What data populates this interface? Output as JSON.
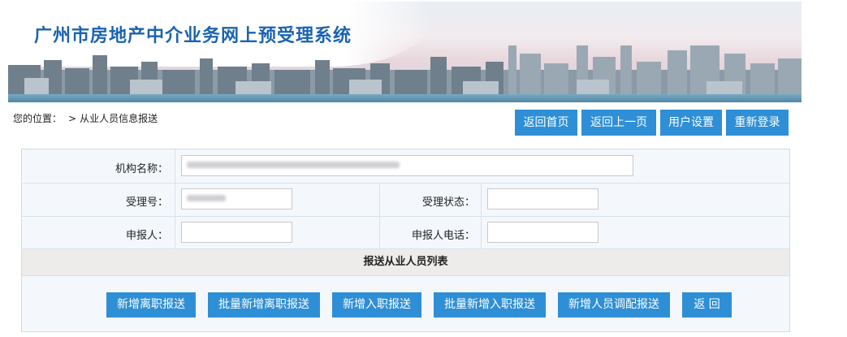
{
  "header": {
    "title": "广州市房地产中介业务网上预受理系统"
  },
  "breadcrumb": {
    "label": "您的位置：",
    "separator": ">",
    "current": "从业人员信息报送"
  },
  "nav": {
    "home": "返回首页",
    "back": "返回上一页",
    "user_settings": "用户设置",
    "relogin": "重新登录"
  },
  "form": {
    "org_name_label": "机构名称：",
    "acceptance_no_label": "受理号：",
    "acceptance_status_label": "受理状态：",
    "applicant_label": "申报人：",
    "applicant_phone_label": "申报人电话：",
    "section_title": "报送从业人员列表"
  },
  "actions": {
    "add_resign": "新增离职报送",
    "batch_add_resign": "批量新增离职报送",
    "add_join": "新增入职报送",
    "batch_add_join": "批量新增入职报送",
    "add_transfer": "新增人员调配报送",
    "back": "返 回"
  },
  "colors": {
    "accent": "#2e8fd6",
    "title": "#1a63b0"
  }
}
